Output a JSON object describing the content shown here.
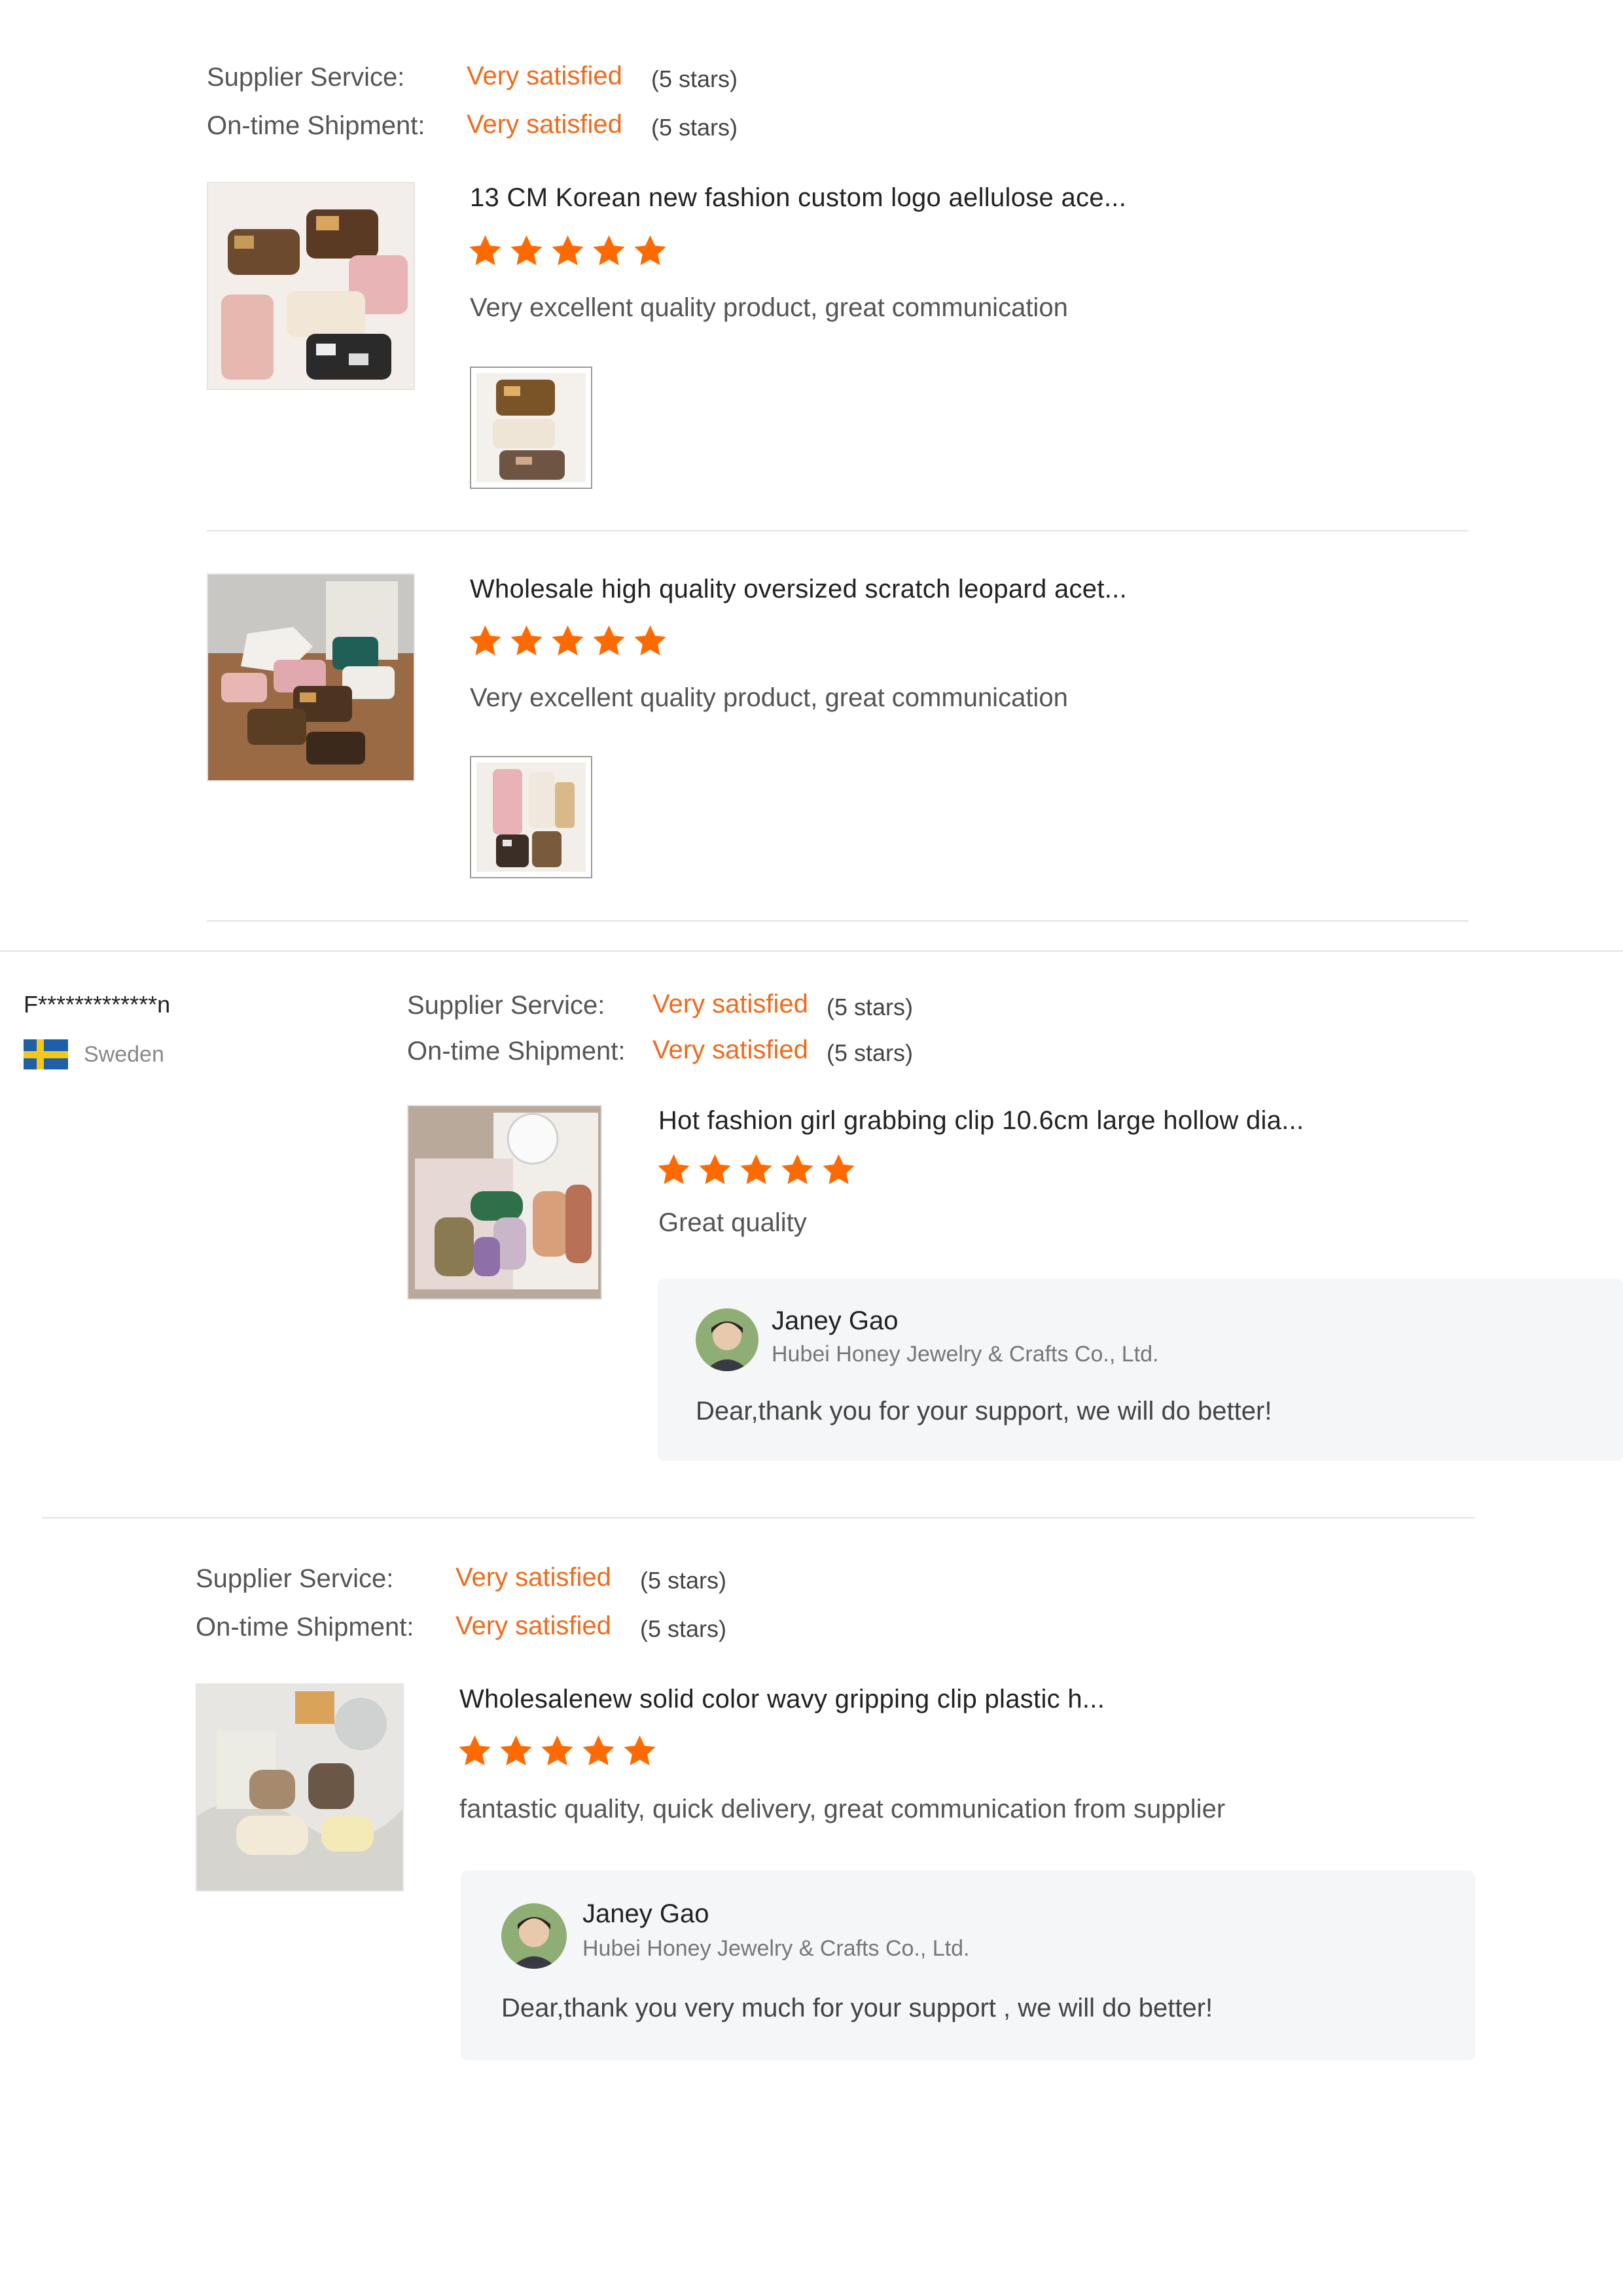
{
  "colors": {
    "accent": "#f06a1b",
    "star": "#ff6a00",
    "divider": "#e2e2e2",
    "reply_bg": "#f5f6f8"
  },
  "labels": {
    "supplier_service": "Supplier Service:",
    "ontime_shipment": "On-time Shipment:",
    "very_satisfied": "Very satisfied",
    "five_stars": "(5 stars)"
  },
  "review1": {
    "products": [
      {
        "title": "13 CM Korean new fashion custom logo aellulose ace...",
        "rating": 5,
        "comment": "Very excellent quality product, great communication",
        "image": "hair-claw-clips-product-photo",
        "attachment": "hair-claw-clips-attachment-photo"
      },
      {
        "title": "Wholesale high quality oversized scratch leopard acet...",
        "rating": 5,
        "comment": "Very excellent quality product, great communication",
        "image": "hair-claw-clips-product-photo",
        "attachment": "hair-claw-clips-attachment-photo"
      }
    ]
  },
  "review2": {
    "buyer": "F*************n",
    "country": "Sweden",
    "flag": "sweden-flag-icon",
    "product": {
      "title": "Hot fashion girl grabbing clip 10.6cm large hollow dia...",
      "rating": 5,
      "comment": "Great quality"
    },
    "reply": {
      "name": "Janey Gao",
      "company": "Hubei Honey Jewelry & Crafts Co., Ltd.",
      "text": "Dear,thank you for your support, we will do better!"
    }
  },
  "review3": {
    "product": {
      "title": "Wholesalenew solid color wavy gripping clip plastic h...",
      "rating": 5,
      "comment": "fantastic quality, quick delivery, great communication from supplier"
    },
    "reply": {
      "name": "Janey Gao",
      "company": "Hubei Honey Jewelry & Crafts Co., Ltd.",
      "text": "Dear,thank you very much for your support , we will do better!"
    }
  }
}
